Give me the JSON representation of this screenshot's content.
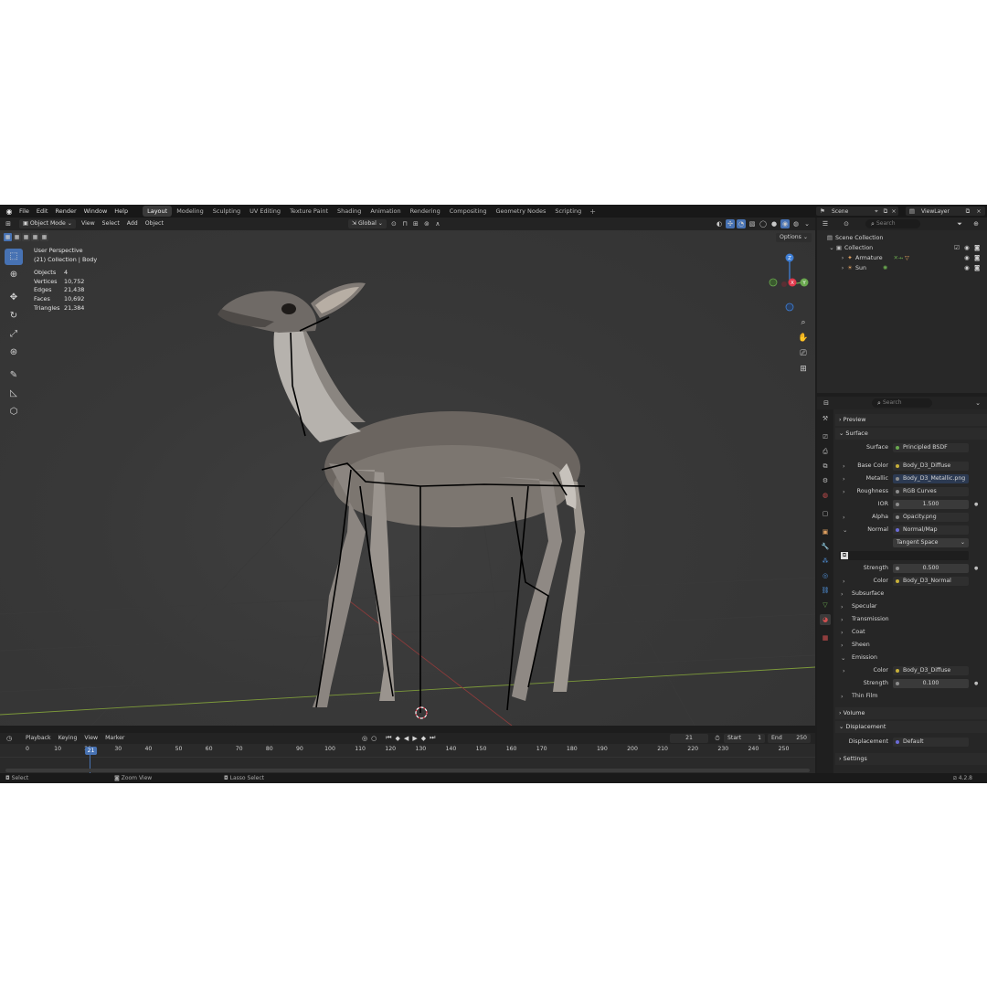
{
  "topbar": {
    "menus": [
      "File",
      "Edit",
      "Render",
      "Window",
      "Help"
    ],
    "workspaces": [
      "Layout",
      "Modeling",
      "Sculpting",
      "UV Editing",
      "Texture Paint",
      "Shading",
      "Animation",
      "Rendering",
      "Compositing",
      "Geometry Nodes",
      "Scripting"
    ],
    "active_workspace": "Layout",
    "add_tab": "+",
    "scene": "Scene",
    "view_layer": "ViewLayer"
  },
  "viewport_header": {
    "mode": "Object Mode",
    "menus": [
      "View",
      "Select",
      "Add",
      "Object"
    ],
    "orientation": "Global",
    "options": "Options"
  },
  "viewport_overlay": {
    "perspective": "User Perspective",
    "collection": "(21) Collection | Body",
    "stats": [
      {
        "label": "Objects",
        "value": "4"
      },
      {
        "label": "Vertices",
        "value": "10,752"
      },
      {
        "label": "Edges",
        "value": "21,438"
      },
      {
        "label": "Faces",
        "value": "10,692"
      },
      {
        "label": "Triangles",
        "value": "21,384"
      }
    ]
  },
  "gizmo": {
    "x": "X",
    "y": "Y",
    "z": "Z"
  },
  "timeline": {
    "menus": [
      "Playback",
      "Keying",
      "View",
      "Marker"
    ],
    "current_frame": "21",
    "start_label": "Start",
    "start": "1",
    "end_label": "End",
    "end": "250",
    "cursor_label": "21",
    "ticks": [
      "0",
      "10",
      "20",
      "30",
      "40",
      "50",
      "60",
      "70",
      "80",
      "90",
      "100",
      "110",
      "120",
      "130",
      "140",
      "150",
      "160",
      "170",
      "180",
      "190",
      "200",
      "210",
      "220",
      "230",
      "240",
      "250"
    ]
  },
  "statusbar": {
    "select": "Select",
    "zoom": "Zoom View",
    "lasso": "Lasso Select",
    "version": "4.2.8"
  },
  "outliner": {
    "search_placeholder": "Search",
    "scene_collection": "Scene Collection",
    "collection": "Collection",
    "armature": "Armature",
    "sun": "Sun"
  },
  "properties": {
    "search_placeholder": "Search",
    "preview": "Preview",
    "surface": "Surface",
    "surface_label": "Surface",
    "surface_value": "Principled BSDF",
    "base_color_label": "Base Color",
    "base_color_value": "Body_D3_Diffuse",
    "metallic_label": "Metallic",
    "metallic_value": "Body_D3_Metallic.png",
    "roughness_label": "Roughness",
    "roughness_value": "RGB Curves",
    "ior_label": "IOR",
    "ior_value": "1.500",
    "alpha_label": "Alpha",
    "alpha_value": "Opacity.png",
    "normal_label": "Normal",
    "normal_value": "Normal/Map",
    "tangent_value": "Tangent Space",
    "strength_label": "Strength",
    "strength_value": "0.500",
    "color_label": "Color",
    "color_value": "Body_D3_Normal",
    "subsurface": "Subsurface",
    "specular": "Specular",
    "transmission": "Transmission",
    "coat": "Coat",
    "sheen": "Sheen",
    "emission": "Emission",
    "emission_color_label": "Color",
    "emission_color_value": "Body_D3_Diffuse",
    "emission_strength_label": "Strength",
    "emission_strength_value": "0.100",
    "thin_film": "Thin Film",
    "volume": "Volume",
    "displacement": "Displacement",
    "displacement_label": "Displacement",
    "displacement_value": "Default",
    "settings": "Settings"
  },
  "colors": {
    "accent": "#4772b3",
    "axis_x": "#e0394c",
    "axis_y": "#6aa84f",
    "axis_z": "#3f7fd6",
    "socket_yellow": "#c7b03a",
    "socket_gray": "#8c8c8c",
    "socket_purple": "#6b6bd6"
  }
}
